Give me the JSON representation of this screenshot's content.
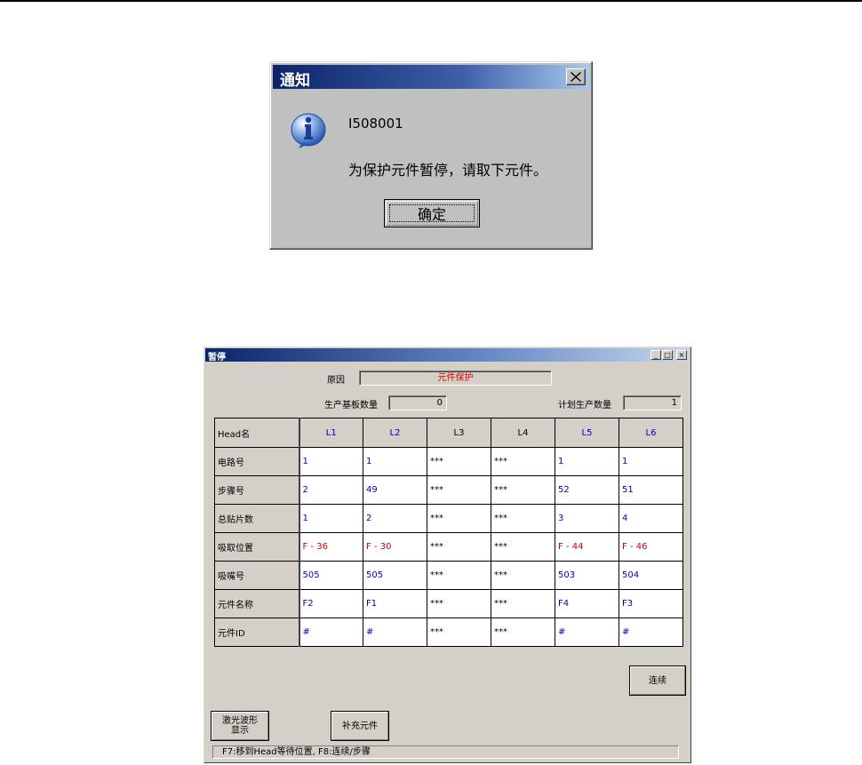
{
  "notification": {
    "title": "通知",
    "code": "I508001",
    "message": "为保护元件暂停，请取下元件。",
    "ok_label": "确定"
  },
  "pause_window": {
    "title": "暂停",
    "reason_label": "原因",
    "reason_value": "元件保护",
    "produced_label": "生产基板数量",
    "produced_value": "0",
    "planned_label": "计划生产数量",
    "planned_value": "1",
    "table": {
      "header_label": "Head名",
      "columns": [
        {
          "label": "L1",
          "active": true
        },
        {
          "label": "L2",
          "active": true
        },
        {
          "label": "L3",
          "active": false
        },
        {
          "label": "L4",
          "active": false
        },
        {
          "label": "L5",
          "active": true
        },
        {
          "label": "L6",
          "active": true
        }
      ],
      "rows": [
        {
          "label": "电路号",
          "values": [
            "1",
            "1",
            "***",
            "***",
            "1",
            "1"
          ]
        },
        {
          "label": "步骤号",
          "values": [
            "2",
            "49",
            "***",
            "***",
            "52",
            "51"
          ]
        },
        {
          "label": "总贴片数",
          "values": [
            "1",
            "2",
            "***",
            "***",
            "3",
            "4"
          ]
        },
        {
          "label": "吸取位置",
          "values": [
            "F - 36",
            "F - 30",
            "***",
            "***",
            "F - 44",
            "F - 46"
          ],
          "highlight": true
        },
        {
          "label": "吸嘴号",
          "values": [
            "505",
            "505",
            "***",
            "***",
            "503",
            "504"
          ]
        },
        {
          "label": "元件名称",
          "values": [
            "F2",
            "F1",
            "***",
            "***",
            "F4",
            "F3"
          ]
        },
        {
          "label": "元件ID",
          "values": [
            "#",
            "#",
            "***",
            "***",
            "#",
            "#"
          ]
        }
      ]
    },
    "continue_label": "连续",
    "laser_label": "激光波形显示",
    "laser_line1": "激光波形",
    "laser_line2": "显示",
    "supplement_label": "补充元件",
    "status_text": "F7:移到Head等待位置,  F8:连续/步骤"
  },
  "colors": {
    "active_text": "#0000c8",
    "highlight_text": "#d00000",
    "title_bar": "#0a246a"
  },
  "icons": [
    "info-icon",
    "close-icon",
    "minimize-icon",
    "maximize-icon"
  ]
}
